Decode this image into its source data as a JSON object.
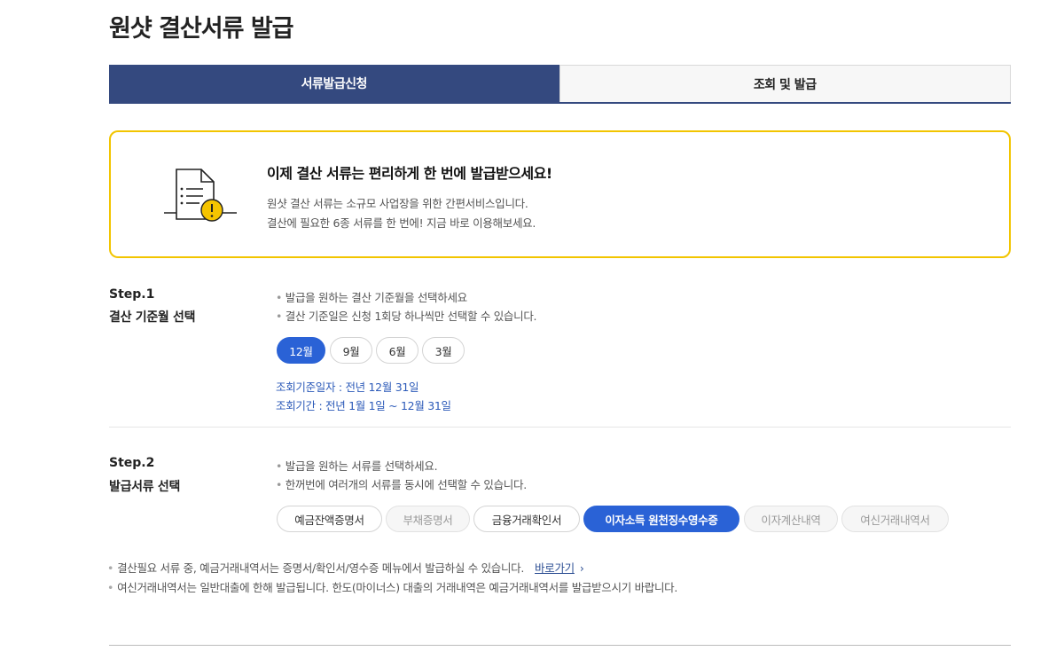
{
  "page": {
    "title": "원샷 결산서류 발급"
  },
  "tabs": [
    {
      "label": "서류발급신청"
    },
    {
      "label": "조회 및 발급"
    }
  ],
  "notice": {
    "title": "이제 결산 서류는 편리하게 한 번에 발급받으세요!",
    "line1": "원샷 결산 서류는 소규모 사업장을 위한 간편서비스입니다.",
    "line2": "결산에 필요한 6종 서류를 한 번에! 지금 바로 이용해보세요.",
    "icon": "document-warning-icon"
  },
  "step1": {
    "label": "Step.1",
    "title": "결산 기준월 선택",
    "guides": [
      "발급을 원하는 결산 기준월을 선택하세요",
      "결산 기준일은 신청 1회당 하나씩만 선택할 수 있습니다."
    ],
    "months": [
      "12월",
      "9월",
      "6월",
      "3월"
    ],
    "selected_month": "12월",
    "base_date": "조회기준일자 : 전년 12월 31일",
    "period": "조회기간 : 전년 1월 1일 ~ 12월 31일"
  },
  "step2": {
    "label": "Step.2",
    "title": "발급서류 선택",
    "guides": [
      "발급을 원하는 서류를 선택하세요.",
      "한꺼번에 여러개의 서류를 동시에 선택할 수 있습니다."
    ],
    "docs": [
      "예금잔액증명서",
      "부채증명서",
      "금융거래확인서",
      "이자소득 원천징수영수증",
      "이자계산내역",
      "여신거래내역서"
    ]
  },
  "footnotes": {
    "note1": "결산필요 서류 중, 예금거래내역서는 증명서/확인서/영수증 메뉴에서 발급하실 수 있습니다.",
    "note1_link": "바로가기",
    "note2": "여신거래내역서는 일반대출에 한해 발급됩니다. 한도(마이너스) 대출의 거래내역은 예금거래내역서를 발급받으시기 바랍니다."
  },
  "colors": {
    "primary_tab": "#34497f",
    "accent_blue": "#2a62d6",
    "notice_border": "#f2c500"
  }
}
